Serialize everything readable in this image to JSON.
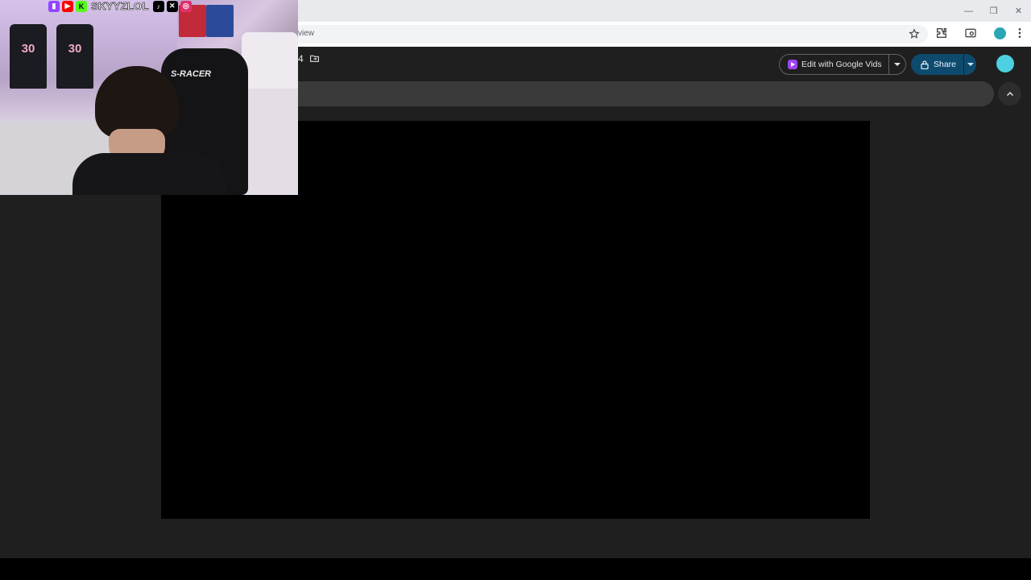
{
  "browser": {
    "url_fragment": "view",
    "window_controls": [
      "—",
      "❐",
      "✕"
    ]
  },
  "app": {
    "title_fragment": "4",
    "vids_button_label": "Edit with Google Vids",
    "share_label": "Share"
  },
  "webcam": {
    "handle": "SKYYZLOL",
    "social_icons": [
      "twitch-icon",
      "youtube-icon",
      "kick-icon",
      "tiktok-icon",
      "x-icon",
      "instagram-icon"
    ],
    "jersey_numbers": [
      "30",
      "30"
    ],
    "chair_brand": "S-RACER"
  },
  "colors": {
    "page_bg": "#1f1f1f",
    "share_bg": "#0e4a6e",
    "vids_accent": "#a142f4",
    "slide_bg": "#000000"
  }
}
